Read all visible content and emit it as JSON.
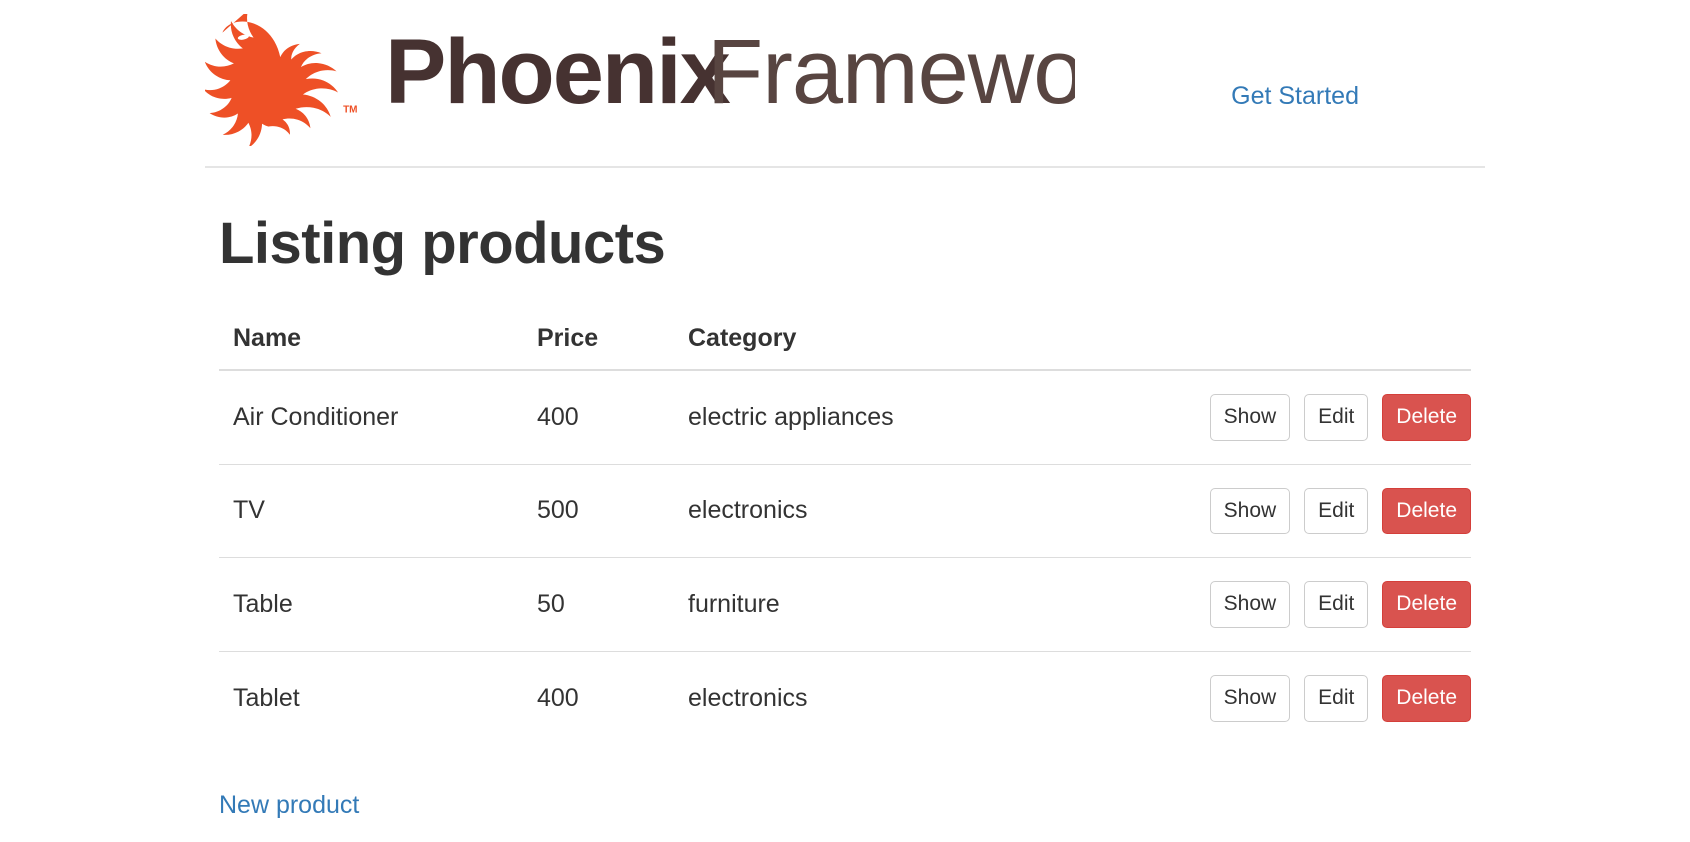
{
  "header": {
    "brand": {
      "logo_icon": "phoenix-bird-logo",
      "wordmark_bold": "Phoenix",
      "wordmark_light": "Framework",
      "trademark": "TM",
      "logo_color": "#ee5026",
      "wordmark_color": "#463231"
    },
    "nav": {
      "get_started_label": "Get Started",
      "link_color": "#337ab7"
    }
  },
  "main": {
    "page_title": "Listing products",
    "table": {
      "columns": [
        "Name",
        "Price",
        "Category",
        ""
      ],
      "rows": [
        {
          "name": "Air Conditioner",
          "price": "400",
          "category": "electric appliances",
          "actions": [
            "Show",
            "Edit",
            "Delete"
          ]
        },
        {
          "name": "TV",
          "price": "500",
          "category": "electronics",
          "actions": [
            "Show",
            "Edit",
            "Delete"
          ]
        },
        {
          "name": "Table",
          "price": "50",
          "category": "furniture",
          "actions": [
            "Show",
            "Edit",
            "Delete"
          ]
        },
        {
          "name": "Tablet",
          "price": "400",
          "category": "electronics",
          "actions": [
            "Show",
            "Edit",
            "Delete"
          ]
        }
      ]
    },
    "new_product_label": "New product",
    "danger_color": "#d9534f"
  }
}
